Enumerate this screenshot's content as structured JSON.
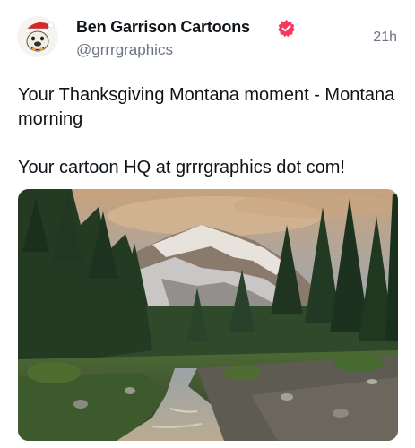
{
  "post": {
    "author": {
      "display_name": "Ben Garrison Cartoons",
      "handle": "@grrrgraphics",
      "verified": true,
      "avatar_icon": "bulldog-santa-hat-avatar"
    },
    "timestamp": "21h",
    "text_paragraphs": [
      "Your Thanksgiving Montana moment - Montana morning",
      "Your cartoon HQ at grrrgraphics dot com!"
    ],
    "media": {
      "type": "photo",
      "icon": "mountain-landscape-photo"
    }
  },
  "colors": {
    "verified_badge": "#f4385e",
    "muted_text": "#6b7480",
    "primary_text": "#0f1419"
  }
}
